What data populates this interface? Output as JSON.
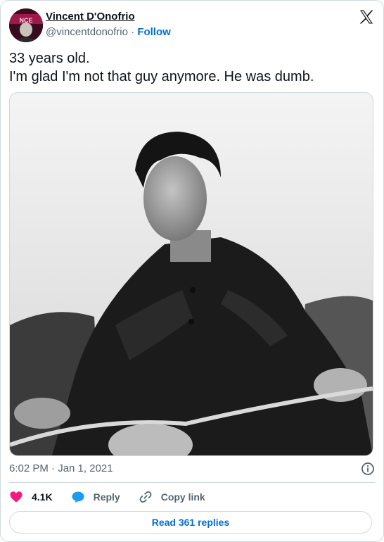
{
  "author": {
    "display_name": "Vincent D'Onofrio",
    "handle": "@vincentdonofrio",
    "separator": "·",
    "follow_label": "Follow"
  },
  "tweet": {
    "text": "33 years old.\nI'm glad I'm not that guy anymore. He was dumb.",
    "timestamp": "6:02 PM · Jan 1, 2021"
  },
  "actions": {
    "likes_count": "4.1K",
    "reply_label": "Reply",
    "copy_link_label": "Copy link"
  },
  "footer": {
    "read_replies_label": "Read 361 replies"
  },
  "icons": {
    "logo": "x-logo-icon",
    "info": "info-icon",
    "like": "heart-icon",
    "reply": "reply-bubble-icon",
    "copy": "link-icon"
  },
  "colors": {
    "like": "#f91880",
    "reply": "#1d9bf0",
    "follow": "#006fd6",
    "secondary_text": "#536471",
    "border": "#cfd9de"
  }
}
